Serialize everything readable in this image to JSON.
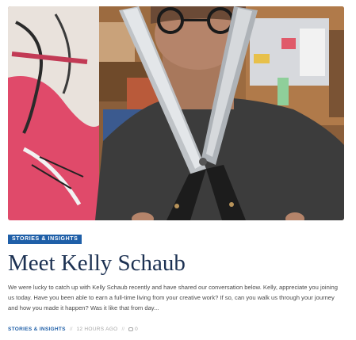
{
  "post": {
    "image_alt": "Photo of Kelly Schaub holding large scissors in her studio",
    "category": "STORIES & INSIGHTS",
    "title": "Meet Kelly Schaub",
    "excerpt": "We were lucky to catch up with Kelly Schaub recently and have shared our conversation below. Kelly, appreciate you joining us today. Have you been able to earn a full-time living from your creative work? If so, can you walk us through your journey and how you made it happen? Was it like that from day...",
    "meta": {
      "category": "STORIES & INSIGHTS",
      "separator": "//",
      "time": "12 HOURS AGO",
      "comments_count": "0"
    }
  },
  "colors": {
    "accent": "#1f5fa8",
    "title": "#1c3152",
    "text": "#4a4a4a",
    "muted": "#a6a6a6"
  }
}
